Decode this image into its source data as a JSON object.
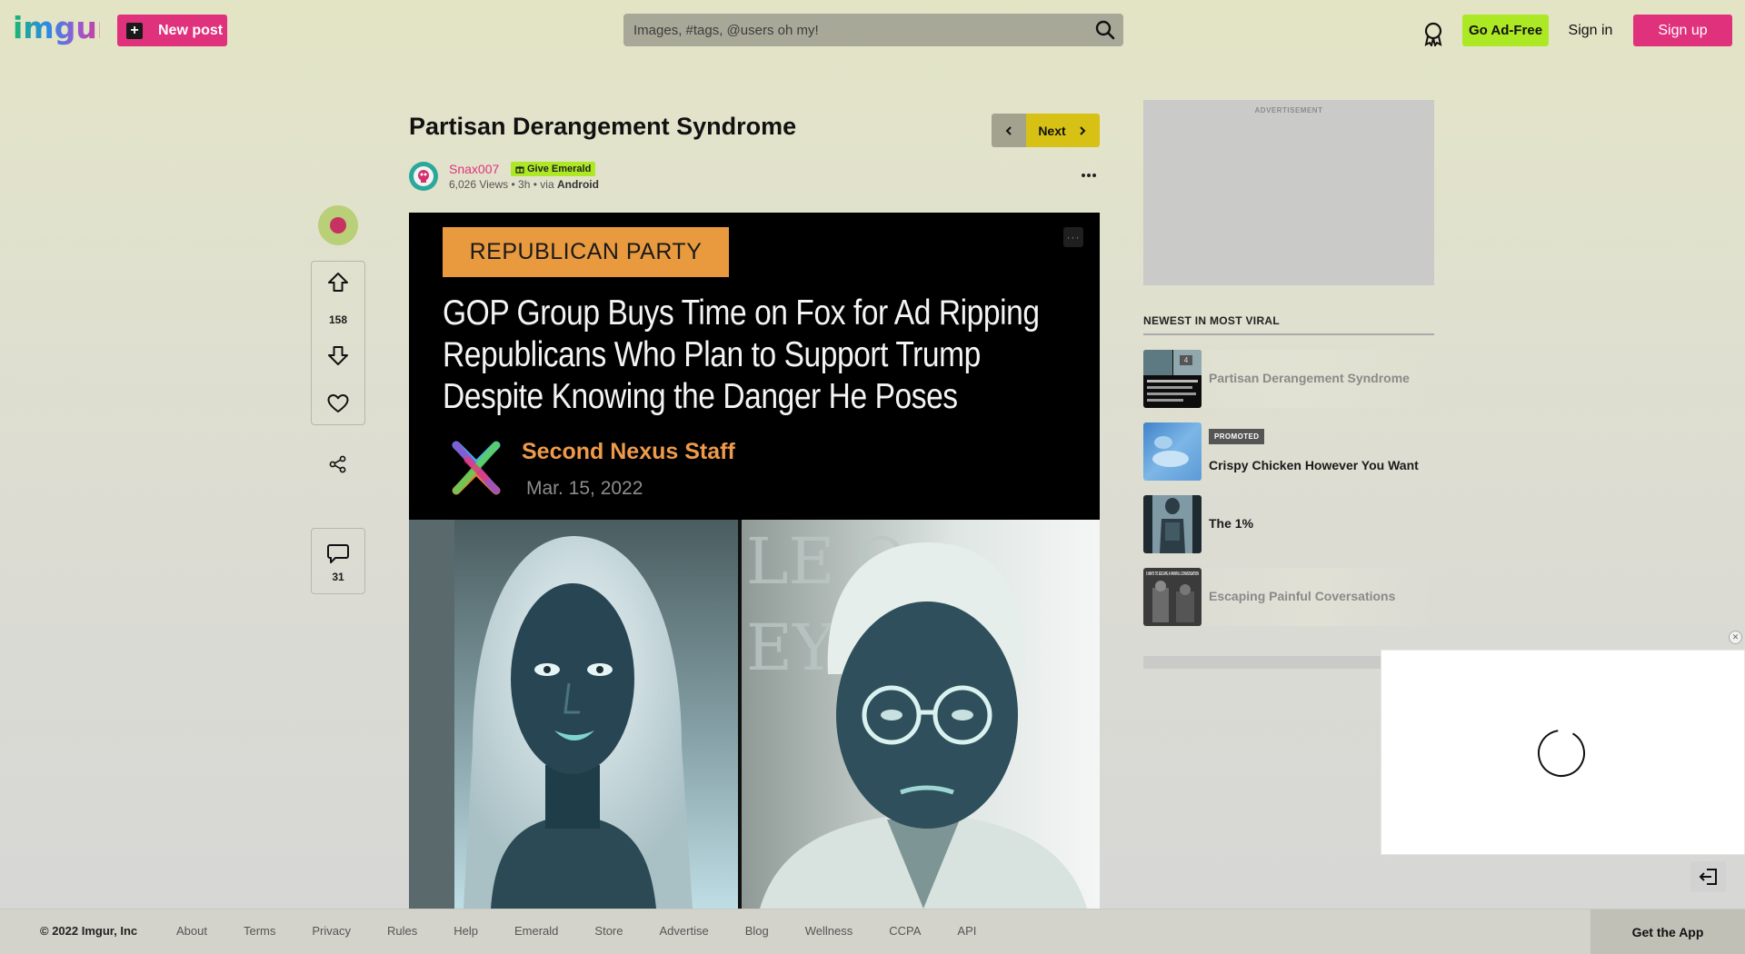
{
  "header": {
    "logo_text": "imgur",
    "new_post_label": "New post",
    "search_placeholder": "Images, #tags, @users oh my!",
    "go_ad_free_label": "Go Ad-Free",
    "sign_in_label": "Sign in",
    "sign_up_label": "Sign up"
  },
  "post": {
    "title": "Partisan Derangement Syndrome",
    "next_label": "Next",
    "author": "Snax007",
    "give_emerald_label": "Give Emerald",
    "views": "6,026 Views",
    "age": "3h",
    "via_prefix": "via",
    "via_platform": "Android",
    "upvotes": "158",
    "comments": "31"
  },
  "image": {
    "party_tag": "REPUBLICAN PARTY",
    "headline": "GOP Group Buys Time on Fox for Ad Ripping Republicans Who Plan to Support Trump Despite Knowing the Danger He Poses",
    "source_name": "Second Nexus Staff",
    "source_date": "Mar. 15, 2022"
  },
  "sidebar": {
    "ad_label": "ADVERTISEMENT",
    "heading": "NEWEST IN MOST VIRAL",
    "items": [
      {
        "title": "Partisan Derangement Syndrome",
        "count": "4"
      },
      {
        "title": "Crispy Chicken However You Want",
        "badge": "PROMOTED"
      },
      {
        "title": "The 1%"
      },
      {
        "title": "Escaping Painful Coversations",
        "thumb_text": "5 WAYS TO ESCAPE A PAINFUL CONVERSATION"
      }
    ]
  },
  "footer": {
    "copyright": "© 2022 Imgur, Inc",
    "links": [
      "About",
      "Terms",
      "Privacy",
      "Rules",
      "Help",
      "Emerald",
      "Store",
      "Advertise",
      "Blog",
      "Wellness",
      "CCPA",
      "API"
    ],
    "get_app_label": "Get the App"
  },
  "colors": {
    "brand_pink": "#e0317c",
    "accent_green": "#ade825",
    "next_yellow": "#d6c114",
    "orange_tag": "#e99a3e"
  },
  "icons": [
    "plus-icon",
    "search-icon",
    "badge-icon",
    "chevron-left-icon",
    "chevron-right-icon",
    "upvote-icon",
    "downvote-icon",
    "heart-icon",
    "share-icon",
    "comment-icon",
    "more-icon",
    "close-icon",
    "exit-icon",
    "spinner-icon"
  ]
}
